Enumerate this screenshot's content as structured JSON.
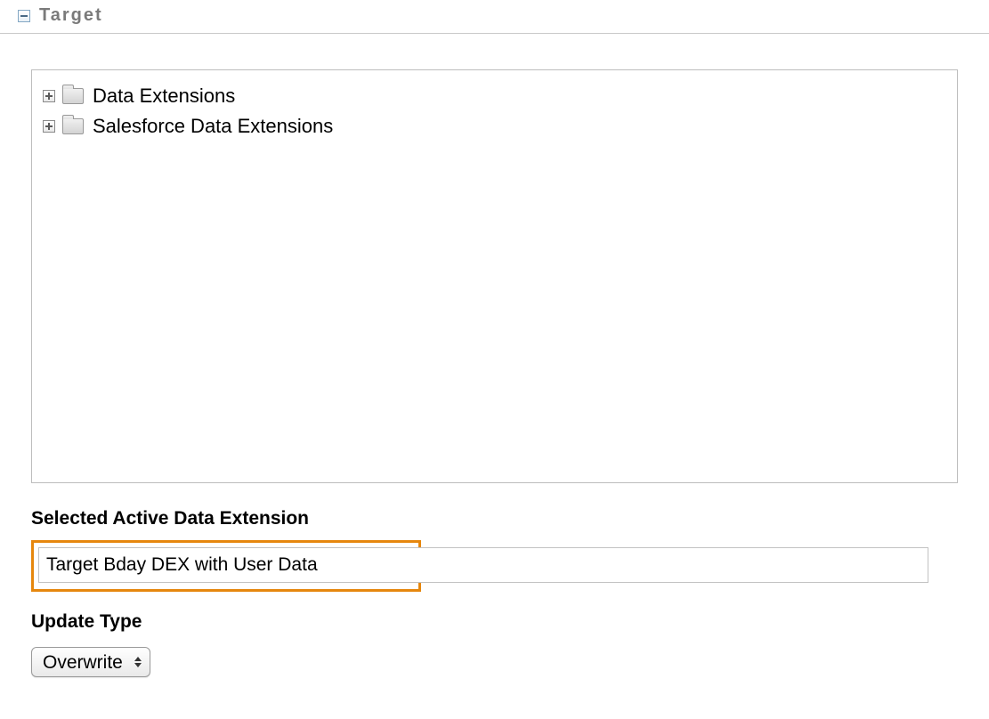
{
  "section": {
    "title": "Target"
  },
  "tree": {
    "items": [
      {
        "label": "Data Extensions"
      },
      {
        "label": "Salesforce Data Extensions"
      }
    ]
  },
  "selected_extension": {
    "label": "Selected Active Data Extension",
    "value": "Target Bday DEX with User Data"
  },
  "update_type": {
    "label": "Update Type",
    "value": "Overwrite"
  }
}
